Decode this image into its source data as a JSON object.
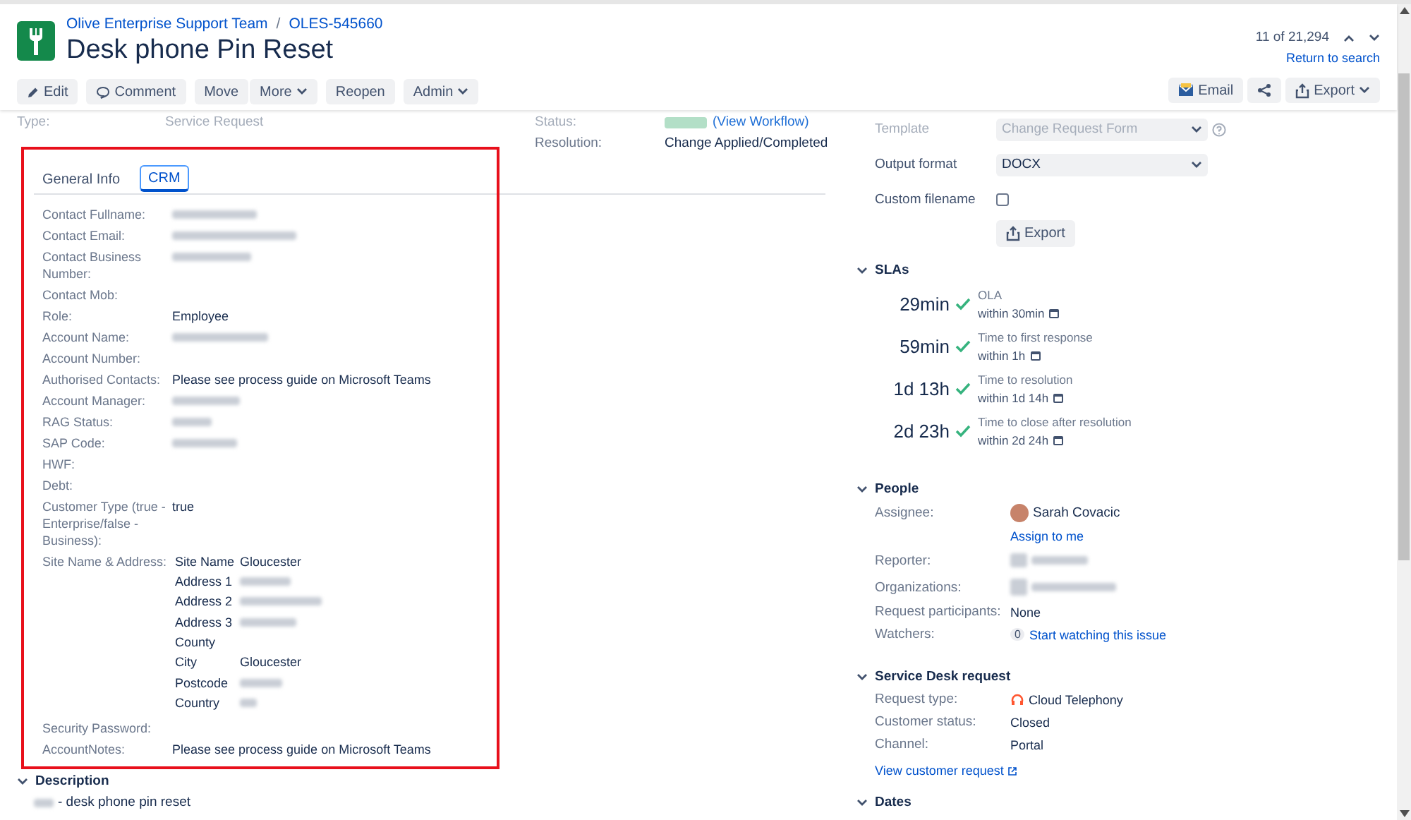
{
  "header": {
    "project": "Olive Enterprise Support Team",
    "separator": "/",
    "issue_key": "OLES-545660",
    "title": "Desk phone Pin Reset",
    "pager": "11 of 21,294",
    "return_link": "Return to search",
    "actions": [
      {
        "label": "Edit",
        "dropdown": false
      },
      {
        "label": "Comment",
        "dropdown": false
      },
      {
        "label": "Move",
        "dropdown": false
      },
      {
        "label": "More",
        "dropdown": true
      },
      {
        "label": "Reopen",
        "dropdown": false
      },
      {
        "label": "Admin",
        "dropdown": true
      }
    ],
    "right_actions": [
      {
        "label": "Email",
        "dropdown": false
      },
      {
        "dropdown": false
      },
      {
        "label": "Export",
        "dropdown": true
      }
    ]
  },
  "summary": {
    "type_label": "Type:",
    "type_value": "Service Request",
    "status_label": "Status:",
    "status_link": "(View Workflow)",
    "resolution_label": "Resolution:",
    "resolution_value": "Change Applied/Completed"
  },
  "tabs": [
    {
      "label": "General Info",
      "selected": false
    },
    {
      "label": "CRM",
      "selected": true
    }
  ],
  "fields": [
    {
      "label": "Contact Fullname:",
      "redacted": true
    },
    {
      "label": "Contact Email:",
      "redacted": true
    },
    {
      "label": "Contact Business Number:",
      "redacted": true
    },
    {
      "label": "Contact Mob:",
      "redacted": false
    },
    {
      "label": "Role:",
      "value": "Employee",
      "redacted": false
    },
    {
      "label": "Account Name:",
      "redacted": true
    },
    {
      "label": "Account Number:",
      "redacted": false
    },
    {
      "label": "Authorised Contacts:",
      "value": "Please see process guide on Microsoft Teams",
      "redacted": false
    },
    {
      "label": "Account Manager:",
      "redacted": true
    },
    {
      "label": "RAG Status:",
      "redacted": true
    },
    {
      "label": "SAP Code:",
      "redacted": true
    },
    {
      "label": "HWF:",
      "redacted": false
    },
    {
      "label": "Debt:",
      "redacted": false
    },
    {
      "label": "Customer Type (true - Enterprise/false - Business):",
      "value": "true",
      "redacted": false
    },
    {
      "label": "Site Name & Address:",
      "address": [
        {
          "label": "Site Name",
          "value": "Gloucester",
          "redacted": false
        },
        {
          "label": "Address 1",
          "redacted": true
        },
        {
          "label": "Address 2",
          "redacted": true
        },
        {
          "label": "Address 3",
          "redacted": true
        },
        {
          "label": "County",
          "redacted": false
        },
        {
          "label": "City",
          "value": "Gloucester",
          "redacted": false
        },
        {
          "label": "Postcode",
          "redacted": true
        },
        {
          "label": "Country",
          "redacted": true
        }
      ]
    },
    {
      "label": "Security Password:",
      "redacted": false
    },
    {
      "label": "AccountNotes:",
      "value": "Please see process guide on Microsoft Teams",
      "redacted": false
    }
  ],
  "description": {
    "heading": "Description",
    "text": "- desk phone pin reset",
    "prefix_redacted": true
  },
  "export_panel": {
    "template_label": "Template",
    "template_value": "Change Request Form",
    "format_label": "Output format",
    "format_value": "DOCX",
    "filename_label": "Custom filename",
    "filename_checked": false,
    "button": "Export"
  },
  "slas": {
    "heading": "SLAs",
    "items": [
      {
        "time": "29min",
        "name": "OLA",
        "goal": "within 30min",
        "met": true
      },
      {
        "time": "59min",
        "name": "Time to first response",
        "goal": "within 1h",
        "met": true
      },
      {
        "time": "1d 13h",
        "name": "Time to resolution",
        "goal": "within 1d 14h",
        "met": true
      },
      {
        "time": "2d 23h",
        "name": "Time to close after resolution",
        "goal": "within 2d 24h",
        "met": true
      }
    ]
  },
  "people": {
    "heading": "People",
    "assignee_label": "Assignee:",
    "assignee": "Sarah Covacic",
    "assign_link": "Assign to me",
    "reporter_label": "Reporter:",
    "organizations_label": "Organizations:",
    "participants_label": "Request participants:",
    "participants": "None",
    "watchers_label": "Watchers:",
    "watchers_count": "0",
    "watch_link": "Start watching this issue"
  },
  "service_desk": {
    "heading": "Service Desk request",
    "request_type_label": "Request type:",
    "request_type": "Cloud Telephony",
    "customer_status_label": "Customer status:",
    "customer_status": "Closed",
    "channel_label": "Channel:",
    "channel": "Portal",
    "view_link": "View customer request"
  },
  "dates": {
    "heading": "Dates"
  }
}
